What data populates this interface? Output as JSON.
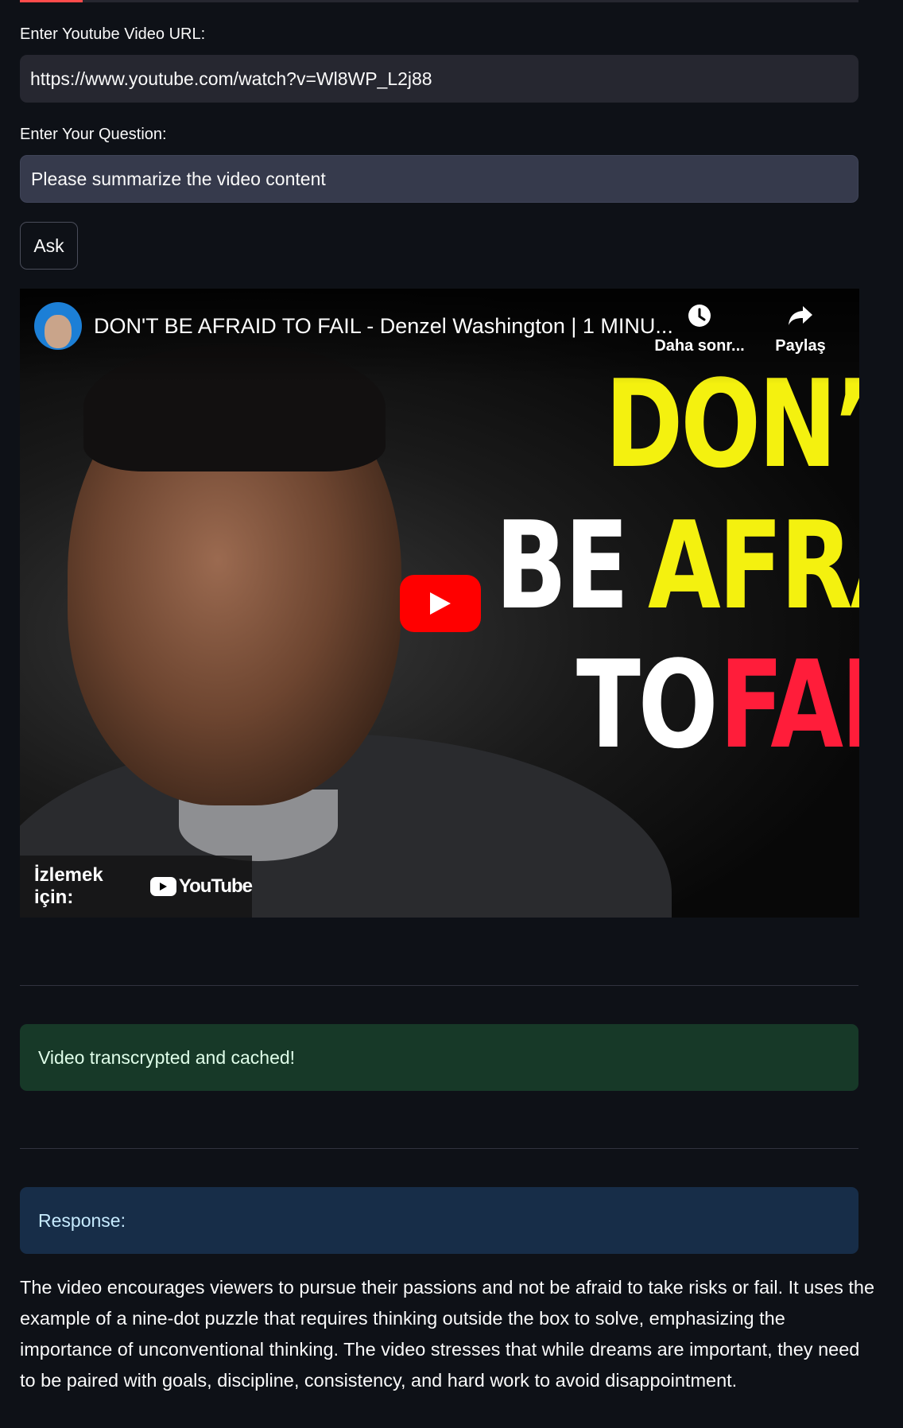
{
  "progress": {
    "fraction": 0.075,
    "color": "#ff4b4b"
  },
  "form": {
    "url_label": "Enter Youtube Video URL:",
    "url_value": "https://www.youtube.com/watch?v=Wl8WP_L2j88",
    "question_label": "Enter Your Question:",
    "question_value": "Please summarize the video content",
    "ask_label": "Ask"
  },
  "video": {
    "title": "DON'T BE AFRAID TO FAIL - Denzel Washington | 1 MINU...",
    "watch_later_label": "Daha sonr...",
    "share_label": "Paylaş",
    "watch_on_label": "İzlemek için:",
    "youtube_logo_text": "YouTube",
    "thumbnail_text": {
      "line1": "DON’T",
      "line2a": "BE",
      "line2b": "AFRA",
      "line3a": "TO",
      "line3b": "FAI"
    }
  },
  "status": {
    "success_message": "Video transcrypted and cached!",
    "response_label": "Response:"
  },
  "response": {
    "text": "The video encourages viewers to pursue their passions and not be afraid to take risks or fail. It uses the example of a nine-dot puzzle that requires thinking outside the box to solve, emphasizing the importance of unconventional thinking. The video stresses that while dreams are important, they need to be paired with goals, discipline, consistency, and hard work to avoid disappointment."
  },
  "colors": {
    "background": "#0e1117",
    "success_bg": "#173928",
    "info_bg": "#172d48",
    "youtube_red": "#ff0000"
  }
}
